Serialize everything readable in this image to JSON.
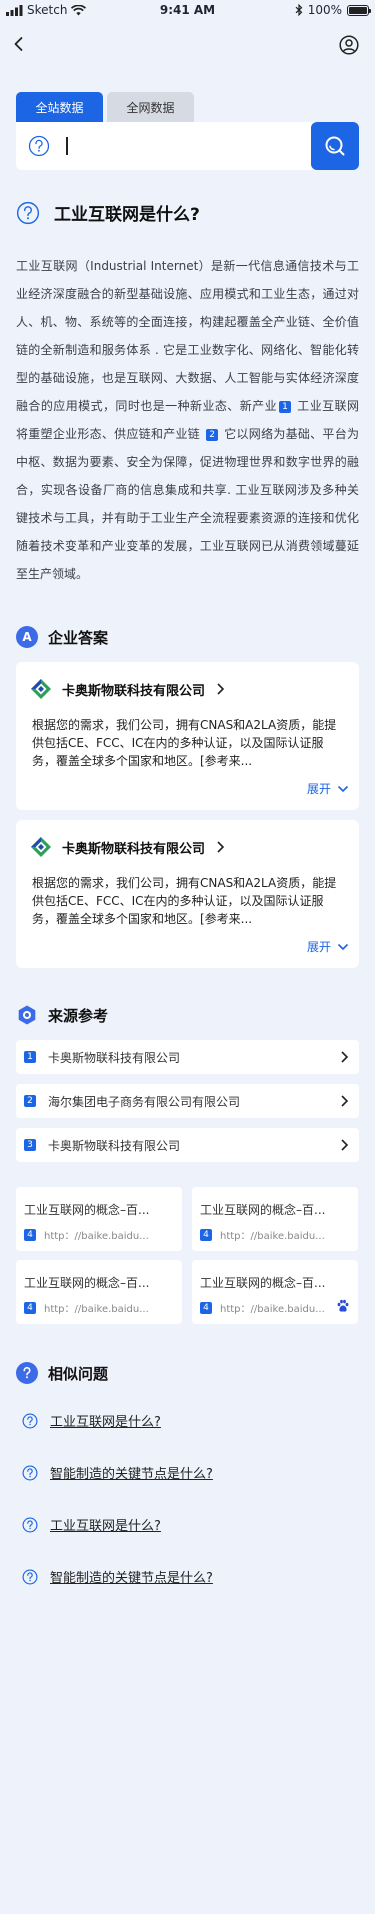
{
  "status": {
    "carrier": "Sketch",
    "time": "9:41 AM",
    "battery": "100%"
  },
  "tabs": [
    {
      "label": "全站数据"
    },
    {
      "label": "全网数据"
    }
  ],
  "search": {
    "value": ""
  },
  "question": {
    "title": "工业互联网是什么?",
    "answer_parts": [
      "工业互联网（Industrial Internet）是新一代信息通信技术与工业经济深度融合的新型基础设施、应用模式和工业生态，通过对人、机、物、系统等的全面连接，构建起覆盖全产业链、全价值链的全新制造和服务体系 . 它是工业数字化、网络化、智能化转型的基础设施，也是互联网、大数据、人工智能与实体经济深度融合的应用模式，同时也是一种新业态、新产业",
      "1",
      " 工业互联网将重塑企业形态、供应链和产业链 ",
      "2",
      " 它以网络为基础、平台为中枢、数据为要素、安全为保障，促进物理世界和数字世界的融合，实现各设备厂商的信息集成和共享. 工业互联网涉及多种关键技术与工具，并有助于工业生产全流程要素资源的连接和优化 随着技术变革和产业变革的发展，工业互联网已从消费领域蔓延至生产领域。"
    ]
  },
  "enterprise": {
    "heading": "企业答案",
    "badge": "A",
    "cards": [
      {
        "company": "卡奥斯物联科技有限公司",
        "text": "根据您的需求，我们公司，拥有CNAS和A2LA资质，能提供包括CE、FCC、IC在内的多种认证，以及国际认证服务，覆盖全球多个国家和地区。[参考来...",
        "expand": "展开"
      },
      {
        "company": "卡奥斯物联科技有限公司",
        "text": "根据您的需求，我们公司，拥有CNAS和A2LA资质，能提供包括CE、FCC、IC在内的多种认证，以及国际认证服务，覆盖全球多个国家和地区。[参考来...",
        "expand": "展开"
      }
    ]
  },
  "sources": {
    "heading": "来源参考",
    "items": [
      {
        "num": "1",
        "name": "卡奥斯物联科技有限公司"
      },
      {
        "num": "2",
        "name": "海尔集团电子商务有限公司有限公司"
      },
      {
        "num": "3",
        "name": "卡奥斯物联科技有限公司"
      }
    ],
    "refs": [
      {
        "title": "工业互联网的概念–百...",
        "num": "4",
        "url": "http：//baike.baidu..."
      },
      {
        "title": "工业互联网的概念–百...",
        "num": "4",
        "url": "http：//baike.baidu..."
      },
      {
        "title": "工业互联网的概念–百...",
        "num": "4",
        "url": "http：//baike.baidu..."
      },
      {
        "title": "工业互联网的概念–百...",
        "num": "4",
        "url": "http：//baike.baidu..."
      }
    ]
  },
  "related": {
    "heading": "相似问题",
    "items": [
      {
        "text": "工业互联网是什么?"
      },
      {
        "text": "智能制造的关键节点是什么?"
      },
      {
        "text": "工业互联网是什么?"
      },
      {
        "text": "智能制造的关键节点是什么?"
      }
    ]
  },
  "colors": {
    "accent": "#1c66e5",
    "background": "#eef2fb"
  }
}
